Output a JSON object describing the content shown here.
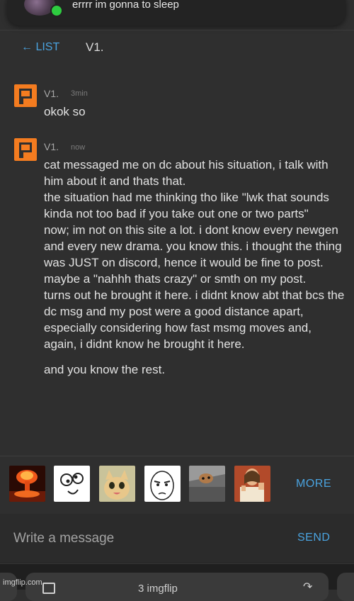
{
  "notification": {
    "text": "errrr im gonna to sleep"
  },
  "header": {
    "back_label": "← LIST",
    "title": "V1."
  },
  "messages": [
    {
      "author": "V1.",
      "time": "3min",
      "lines": [
        "okok so"
      ]
    },
    {
      "author": "V1.",
      "time": "now",
      "lines": [
        "cat messaged me on dc about his situation, i talk with him about it and thats that.",
        "the situation had me thinking tho like \"lwk that sounds kinda not too bad if you take out one or two parts\"",
        "now; im not on this site a lot. i dont know every newgen and every new drama. you know this. i thought the thing was JUST on discord, hence it would be fine to post. maybe a \"nahhh thats crazy\" or smth on my post.",
        "turns out he brought it here. i didnt know abt that bcs the dc msg and my post were a good distance apart, especially considering how fast msmg moves and, again, i didnt know he brought it here."
      ],
      "final_line": "and you know the rest."
    }
  ],
  "meme_strip": {
    "memes": [
      "nuclear-explosion-meme",
      "derp-face-meme",
      "happy-cat-meme",
      "okay-face-meme",
      "ceiling-cat-meme",
      "buddy-christ-meme"
    ],
    "more_label": "MORE"
  },
  "composer": {
    "placeholder": "Write a message",
    "send_label": "SEND"
  },
  "browser": {
    "url_text": "3 imgflip"
  },
  "watermark": "imgflip.com"
}
